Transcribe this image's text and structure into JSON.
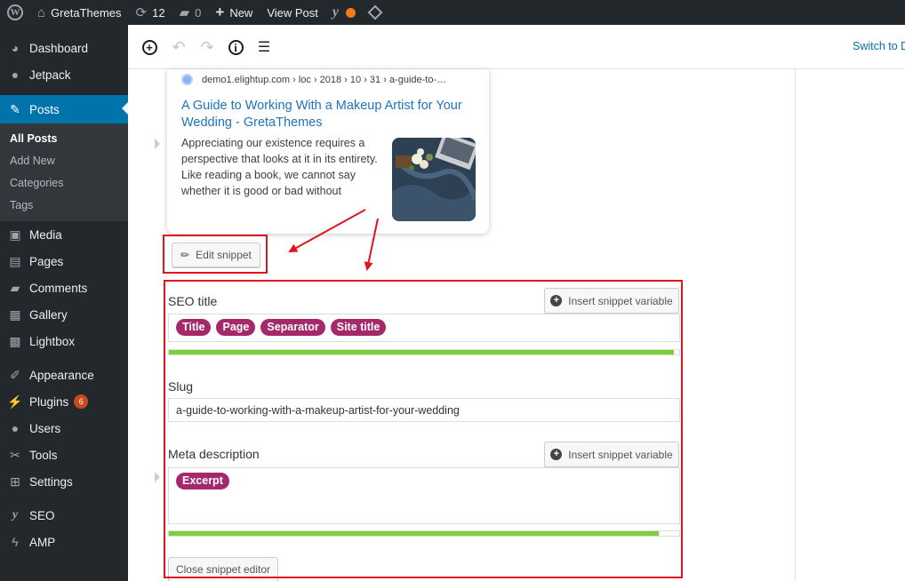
{
  "admin_bar": {
    "site_name": "GretaThemes",
    "updates_count": "12",
    "comments_count": "0",
    "new_label": "New",
    "view_post_label": "View Post"
  },
  "sidebar": {
    "items": [
      {
        "label": "Dashboard",
        "icon": "dashboard-icon"
      },
      {
        "label": "Jetpack",
        "icon": "jetpack-icon"
      },
      {
        "label": "Posts",
        "icon": "pin-icon"
      },
      {
        "label": "Media",
        "icon": "media-icon"
      },
      {
        "label": "Pages",
        "icon": "pages-icon"
      },
      {
        "label": "Comments",
        "icon": "comments-icon"
      },
      {
        "label": "Gallery",
        "icon": "gallery-icon"
      },
      {
        "label": "Lightbox",
        "icon": "lightbox-icon"
      },
      {
        "label": "Appearance",
        "icon": "brush-icon"
      },
      {
        "label": "Plugins",
        "icon": "plug-icon",
        "badge": "6"
      },
      {
        "label": "Users",
        "icon": "users-icon"
      },
      {
        "label": "Tools",
        "icon": "wrench-icon"
      },
      {
        "label": "Settings",
        "icon": "settings-icon"
      },
      {
        "label": "SEO",
        "icon": "yoast-icon"
      },
      {
        "label": "AMP",
        "icon": "amp-icon"
      }
    ],
    "posts_submenu": [
      "All Posts",
      "Add New",
      "Categories",
      "Tags"
    ]
  },
  "toolbar": {
    "switch_label": "Switch to D"
  },
  "preview": {
    "breadcrumb": "demo1.elightup.com › loc › 2018 › 10 › 31 › a-guide-to-…",
    "title": "A Guide to Working With a Makeup Artist for Your Wedding - GretaThemes",
    "description": "Appreciating our existence requires a perspective that looks at it in its entirety. Like reading a book, we cannot say whether it is good or bad without"
  },
  "editor": {
    "edit_snippet_label": "Edit snippet",
    "seo_title_label": "SEO title",
    "insert_variable_label": "Insert snippet variable",
    "title_variables": [
      "Title",
      "Page",
      "Separator",
      "Site title"
    ],
    "seo_title_progress": 0.99,
    "slug_label": "Slug",
    "slug_value": "a-guide-to-working-with-a-makeup-artist-for-your-wedding",
    "meta_label": "Meta description",
    "meta_variables": [
      "Excerpt"
    ],
    "meta_progress": 0.96,
    "close_label": "Close snippet editor"
  },
  "colors": {
    "admin_dark": "#23282d",
    "active_blue": "#0073aa",
    "variable_pill": "#a4286a",
    "progress_green": "#7ad03a",
    "annotation_red": "#e0141e",
    "link_blue": "#1e73be"
  }
}
